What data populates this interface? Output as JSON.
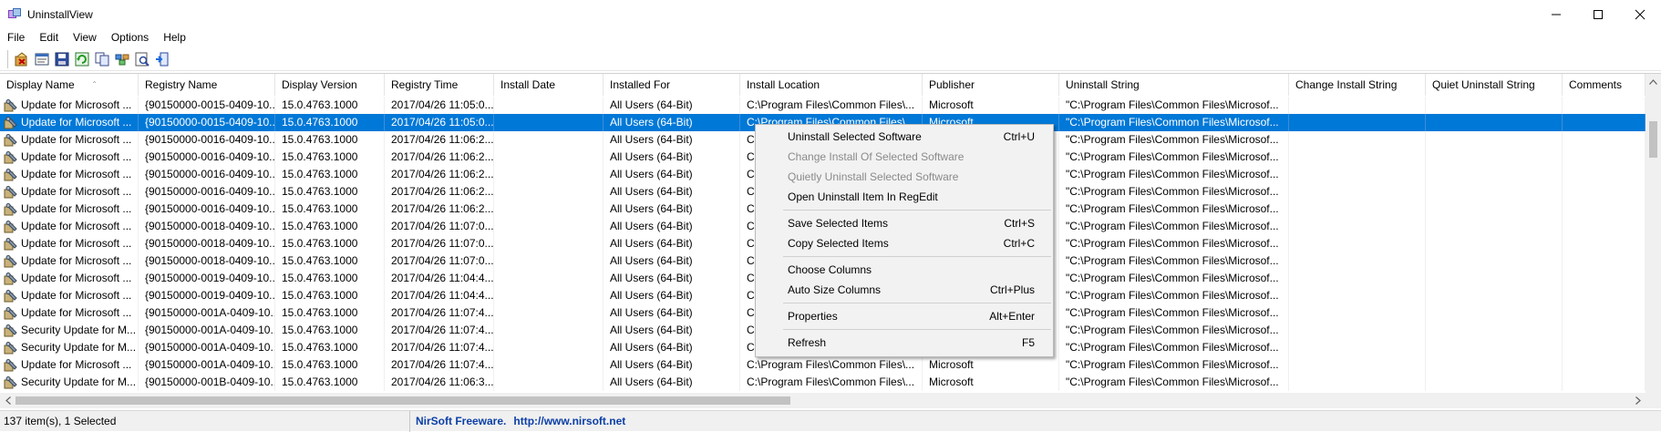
{
  "window": {
    "title": "UninstallView",
    "controls": {
      "minimize": "–",
      "maximize": "☐",
      "close": "✕"
    }
  },
  "menu": [
    "File",
    "Edit",
    "View",
    "Options",
    "Help"
  ],
  "toolbar": {
    "icons": [
      "uninstall-icon",
      "properties-icon",
      "save-icon",
      "refresh-icon",
      "copy-icon",
      "regedit-icon",
      "find-icon",
      "exit-icon"
    ]
  },
  "table": {
    "columns": [
      {
        "label": "Display Name",
        "width": 152
      },
      {
        "label": "Registry Name",
        "width": 150
      },
      {
        "label": "Display Version",
        "width": 120
      },
      {
        "label": "Registry Time",
        "width": 120
      },
      {
        "label": "Install Date",
        "width": 120
      },
      {
        "label": "Installed For",
        "width": 150
      },
      {
        "label": "Install Location",
        "width": 200
      },
      {
        "label": "Publisher",
        "width": 150
      },
      {
        "label": "Uninstall String",
        "width": 252
      },
      {
        "label": "Change Install String",
        "width": 150
      },
      {
        "label": "Quiet Uninstall String",
        "width": 150
      },
      {
        "label": "Comments",
        "width": 91
      }
    ],
    "sort_indicator": "⌃",
    "rows": [
      [
        "Update for Microsoft ...",
        "{90150000-0015-0409-10...",
        "15.0.4763.1000",
        "2017/04/26 11:05:0...",
        "",
        "All Users (64-Bit)",
        "C:\\Program Files\\Common Files\\...",
        "Microsoft",
        "\"C:\\Program Files\\Common Files\\Microsof...",
        "",
        "",
        ""
      ],
      [
        "Update for Microsoft ...",
        "{90150000-0015-0409-10...",
        "15.0.4763.1000",
        "2017/04/26 11:05:0...",
        "",
        "All Users (64-Bit)",
        "C:\\Program Files\\Common Files\\...",
        "Microsoft",
        "\"C:\\Program Files\\Common Files\\Microsof...",
        "",
        "",
        ""
      ],
      [
        "Update for Microsoft ...",
        "{90150000-0016-0409-10...",
        "15.0.4763.1000",
        "2017/04/26 11:06:2...",
        "",
        "All Users (64-Bit)",
        "C:",
        "",
        "\"C:\\Program Files\\Common Files\\Microsof...",
        "",
        "",
        ""
      ],
      [
        "Update for Microsoft ...",
        "{90150000-0016-0409-10...",
        "15.0.4763.1000",
        "2017/04/26 11:06:2...",
        "",
        "All Users (64-Bit)",
        "C:",
        "",
        "\"C:\\Program Files\\Common Files\\Microsof...",
        "",
        "",
        ""
      ],
      [
        "Update for Microsoft ...",
        "{90150000-0016-0409-10...",
        "15.0.4763.1000",
        "2017/04/26 11:06:2...",
        "",
        "All Users (64-Bit)",
        "C:",
        "",
        "\"C:\\Program Files\\Common Files\\Microsof...",
        "",
        "",
        ""
      ],
      [
        "Update for Microsoft ...",
        "{90150000-0016-0409-10...",
        "15.0.4763.1000",
        "2017/04/26 11:06:2...",
        "",
        "All Users (64-Bit)",
        "C:",
        "",
        "\"C:\\Program Files\\Common Files\\Microsof...",
        "",
        "",
        ""
      ],
      [
        "Update for Microsoft ...",
        "{90150000-0016-0409-10...",
        "15.0.4763.1000",
        "2017/04/26 11:06:2...",
        "",
        "All Users (64-Bit)",
        "C:",
        "",
        "\"C:\\Program Files\\Common Files\\Microsof...",
        "",
        "",
        ""
      ],
      [
        "Update for Microsoft ...",
        "{90150000-0018-0409-10...",
        "15.0.4763.1000",
        "2017/04/26 11:07:0...",
        "",
        "All Users (64-Bit)",
        "C:",
        "",
        "\"C:\\Program Files\\Common Files\\Microsof...",
        "",
        "",
        ""
      ],
      [
        "Update for Microsoft ...",
        "{90150000-0018-0409-10...",
        "15.0.4763.1000",
        "2017/04/26 11:07:0...",
        "",
        "All Users (64-Bit)",
        "C:",
        "",
        "\"C:\\Program Files\\Common Files\\Microsof...",
        "",
        "",
        ""
      ],
      [
        "Update for Microsoft ...",
        "{90150000-0018-0409-10...",
        "15.0.4763.1000",
        "2017/04/26 11:07:0...",
        "",
        "All Users (64-Bit)",
        "C:",
        "",
        "\"C:\\Program Files\\Common Files\\Microsof...",
        "",
        "",
        ""
      ],
      [
        "Update for Microsoft ...",
        "{90150000-0019-0409-10...",
        "15.0.4763.1000",
        "2017/04/26 11:04:4...",
        "",
        "All Users (64-Bit)",
        "C:",
        "",
        "\"C:\\Program Files\\Common Files\\Microsof...",
        "",
        "",
        ""
      ],
      [
        "Update for Microsoft ...",
        "{90150000-0019-0409-10...",
        "15.0.4763.1000",
        "2017/04/26 11:04:4...",
        "",
        "All Users (64-Bit)",
        "C:",
        "",
        "\"C:\\Program Files\\Common Files\\Microsof...",
        "",
        "",
        ""
      ],
      [
        "Update for Microsoft ...",
        "{90150000-001A-0409-10...",
        "15.0.4763.1000",
        "2017/04/26 11:07:4...",
        "",
        "All Users (64-Bit)",
        "C:",
        "",
        "\"C:\\Program Files\\Common Files\\Microsof...",
        "",
        "",
        ""
      ],
      [
        "Security Update for M...",
        "{90150000-001A-0409-10...",
        "15.0.4763.1000",
        "2017/04/26 11:07:4...",
        "",
        "All Users (64-Bit)",
        "C:",
        "",
        "\"C:\\Program Files\\Common Files\\Microsof...",
        "",
        "",
        ""
      ],
      [
        "Security Update for M...",
        "{90150000-001A-0409-10...",
        "15.0.4763.1000",
        "2017/04/26 11:07:4...",
        "",
        "All Users (64-Bit)",
        "C:",
        "",
        "\"C:\\Program Files\\Common Files\\Microsof...",
        "",
        "",
        ""
      ],
      [
        "Update for Microsoft ...",
        "{90150000-001A-0409-10...",
        "15.0.4763.1000",
        "2017/04/26 11:07:4...",
        "",
        "All Users (64-Bit)",
        "C:\\Program Files\\Common Files\\...",
        "Microsoft",
        "\"C:\\Program Files\\Common Files\\Microsof...",
        "",
        "",
        ""
      ],
      [
        "Security Update for M...",
        "{90150000-001B-0409-10...",
        "15.0.4763.1000",
        "2017/04/26 11:06:3...",
        "",
        "All Users (64-Bit)",
        "C:\\Program Files\\Common Files\\...",
        "Microsoft",
        "\"C:\\Program Files\\Common Files\\Microsof...",
        "",
        "",
        ""
      ]
    ],
    "selected_row": 1
  },
  "context_menu": [
    {
      "label": "Uninstall Selected Software",
      "shortcut": "Ctrl+U",
      "enabled": true
    },
    {
      "label": "Change Install Of Selected Software",
      "shortcut": "",
      "enabled": false
    },
    {
      "label": "Quietly Uninstall Selected Software",
      "shortcut": "",
      "enabled": false
    },
    {
      "label": "Open Uninstall Item In RegEdit",
      "shortcut": "",
      "enabled": true
    },
    {
      "separator": true
    },
    {
      "label": "Save Selected Items",
      "shortcut": "Ctrl+S",
      "enabled": true
    },
    {
      "label": "Copy Selected Items",
      "shortcut": "Ctrl+C",
      "enabled": true
    },
    {
      "separator": true
    },
    {
      "label": "Choose Columns",
      "shortcut": "",
      "enabled": true
    },
    {
      "label": "Auto Size Columns",
      "shortcut": "Ctrl+Plus",
      "enabled": true
    },
    {
      "separator": true
    },
    {
      "label": "Properties",
      "shortcut": "Alt+Enter",
      "enabled": true
    },
    {
      "separator": true
    },
    {
      "label": "Refresh",
      "shortcut": "F5",
      "enabled": true
    }
  ],
  "status": {
    "count": "137 item(s), 1 Selected",
    "vendor": "NirSoft Freeware.",
    "url": "http://www.nirsoft.net"
  },
  "colors": {
    "selection": "#0078d7",
    "link": "#0b3fa6"
  }
}
